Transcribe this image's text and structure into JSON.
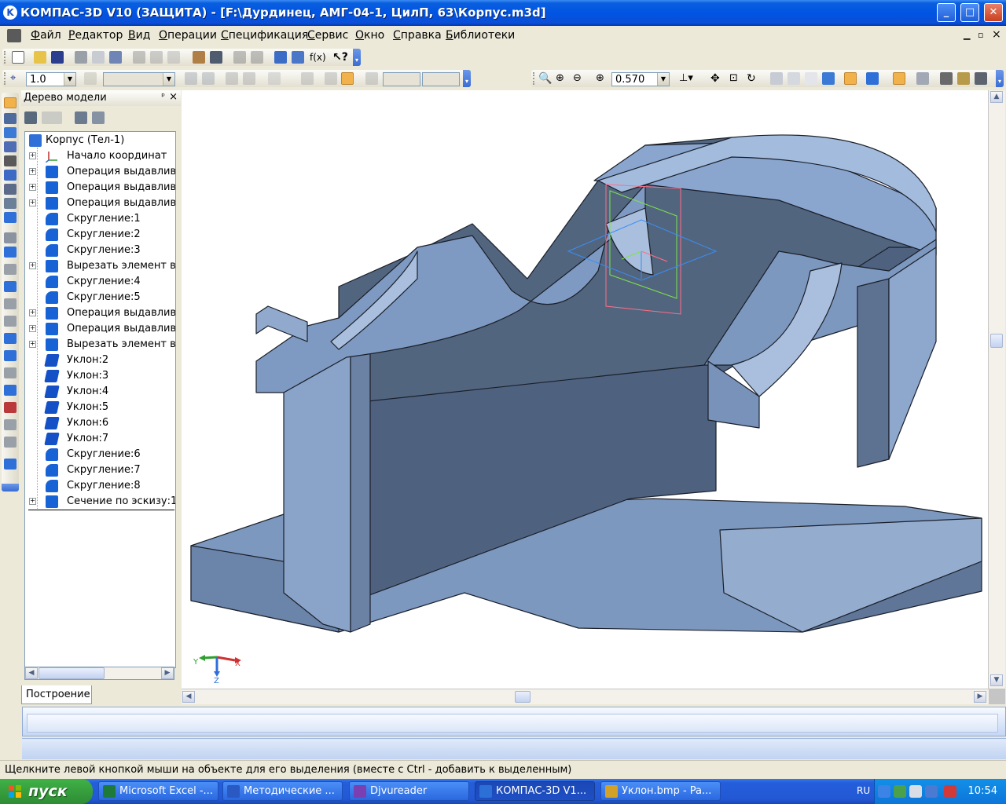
{
  "window": {
    "title": "КОМПАС-3D V10 (ЗАЩИТА) - [F:\\Дурдинец, АМГ-04-1, ЦилП, 63\\Корпус.m3d]",
    "app_icon_letter": "K",
    "minimize_glyph": "_",
    "maximize_glyph": "□",
    "close_glyph": "✕"
  },
  "menu": {
    "items": [
      "Файл",
      "Редактор",
      "Вид",
      "Операции",
      "Спецификация",
      "Сервис",
      "Окно",
      "Справка",
      "Библиотеки"
    ],
    "doc_controls": [
      "×",
      "▫",
      "×"
    ]
  },
  "toolbar2": {
    "step_value": "1.0",
    "zoom_value": "0.570"
  },
  "tree": {
    "title": "Дерево модели",
    "pin_glyph": "ᵖ",
    "close_glyph": "×",
    "root": "Корпус (Тел-1)",
    "nodes": [
      {
        "label": "Начало координат",
        "icon": "axes-icon",
        "expandable": true
      },
      {
        "label": "Операция выдавлива",
        "icon": "extrude-icon",
        "expandable": true
      },
      {
        "label": "Операция выдавлива",
        "icon": "extrude-icon",
        "expandable": true
      },
      {
        "label": "Операция выдавлива",
        "icon": "extrude-icon",
        "expandable": true
      },
      {
        "label": "Скругление:1",
        "icon": "fillet-icon",
        "expandable": false
      },
      {
        "label": "Скругление:2",
        "icon": "fillet-icon",
        "expandable": false
      },
      {
        "label": "Скругление:3",
        "icon": "fillet-icon",
        "expandable": false
      },
      {
        "label": "Вырезать элемент вы",
        "icon": "cut-icon",
        "expandable": true
      },
      {
        "label": "Скругление:4",
        "icon": "fillet-icon",
        "expandable": false
      },
      {
        "label": "Скругление:5",
        "icon": "fillet-icon",
        "expandable": false
      },
      {
        "label": "Операция выдавлива",
        "icon": "extrude-icon",
        "expandable": true
      },
      {
        "label": "Операция выдавлива",
        "icon": "extrude-icon",
        "expandable": true
      },
      {
        "label": "Вырезать элемент вы",
        "icon": "cut-icon",
        "expandable": true
      },
      {
        "label": "Уклон:2",
        "icon": "draft-icon",
        "expandable": false
      },
      {
        "label": "Уклон:3",
        "icon": "draft-icon",
        "expandable": false
      },
      {
        "label": "Уклон:4",
        "icon": "draft-icon",
        "expandable": false
      },
      {
        "label": "Уклон:5",
        "icon": "draft-icon",
        "expandable": false
      },
      {
        "label": "Уклон:6",
        "icon": "draft-icon",
        "expandable": false
      },
      {
        "label": "Уклон:7",
        "icon": "draft-icon",
        "expandable": false
      },
      {
        "label": "Скругление:6",
        "icon": "fillet-icon",
        "expandable": false
      },
      {
        "label": "Скругление:7",
        "icon": "fillet-icon",
        "expandable": false
      },
      {
        "label": "Скругление:8",
        "icon": "fillet-icon",
        "expandable": false
      },
      {
        "label": "Сечение по эскизу:1",
        "icon": "section-icon",
        "expandable": true
      }
    ],
    "tab_label": "Построение"
  },
  "viewport": {
    "axis_x": "X",
    "axis_y": "Y",
    "axis_z": "Z",
    "colors": {
      "part_fill": "#7d98bf",
      "part_dark": "#4a5c76",
      "part_light": "#a9bfdd",
      "edge": "#1a1f29"
    }
  },
  "status": {
    "hint": "Щелкните левой кнопкой мыши на объекте для его выделения (вместе с Ctrl - добавить к выделенным)"
  },
  "taskbar": {
    "start_label": "пуск",
    "tasks": [
      {
        "label": "Microsoft Excel -...",
        "icon": "excel-icon",
        "color": "#1d7a3a",
        "active": false
      },
      {
        "label": "Методические ...",
        "icon": "word-icon",
        "color": "#2b59c3",
        "active": false
      },
      {
        "label": "Djvureader",
        "icon": "djvu-icon",
        "color": "#7a3fb0",
        "active": false
      },
      {
        "label": "КОМПАС-3D V1...",
        "icon": "kompas-icon",
        "color": "#2c6fd6",
        "active": true
      },
      {
        "label": "Уклон.bmp - Pa...",
        "icon": "paint-icon",
        "color": "#d2a12a",
        "active": false
      }
    ],
    "language": "RU",
    "clock": "10:54"
  }
}
